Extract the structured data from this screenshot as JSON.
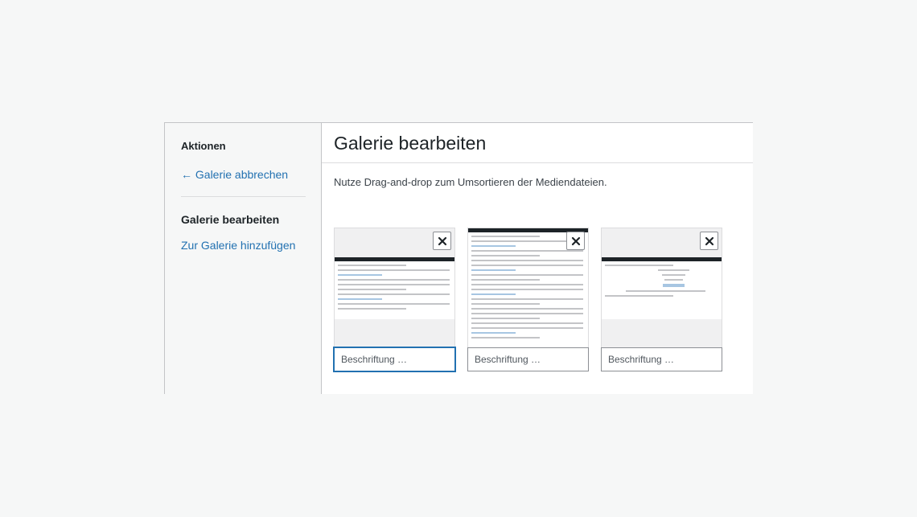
{
  "sidebar": {
    "actions_heading": "Aktionen",
    "cancel_link": "← Galerie abbrechen",
    "section_title": "Galerie bearbeiten",
    "add_link": "Zur Galerie hinzufügen"
  },
  "main": {
    "title": "Galerie bearbeiten",
    "instructions": "Nutze Drag-and-drop zum Umsortieren der Mediendateien."
  },
  "gallery": {
    "items": [
      {
        "caption_placeholder": "Beschriftung …",
        "focused": true
      },
      {
        "caption_placeholder": "Beschriftung …",
        "focused": false
      },
      {
        "caption_placeholder": "Beschriftung …",
        "focused": false
      }
    ]
  },
  "colors": {
    "link": "#2271b1",
    "border": "#c3c4c7",
    "background": "#f6f7f7"
  },
  "icons": {
    "remove": "close-icon"
  }
}
